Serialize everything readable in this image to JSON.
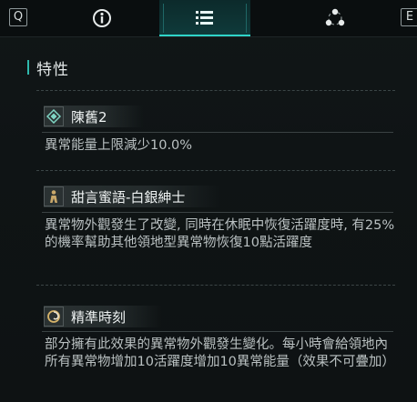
{
  "tabbar": {
    "left_key": "Q",
    "right_key": "E",
    "tabs": [
      {
        "icon": "info-icon"
      },
      {
        "icon": "list-icon",
        "active": true
      },
      {
        "icon": "network-icon"
      }
    ],
    "accent_color": "#2fd4c8"
  },
  "section": {
    "title": "特性"
  },
  "traits": [
    {
      "name": "陳舊2",
      "icon": "diamond-icon",
      "icon_color": "#7fd6c4",
      "description": "異常能量上限減少10.0%"
    },
    {
      "name": "甜言蜜語-白銀紳士",
      "icon": "figure-icon",
      "icon_color": "#c9a86a",
      "description": "異常物外觀發生了改變, 同時在休眠中恢復活躍度時, 有25%的機率幫助其他領地型異常物恢復10點活躍度"
    },
    {
      "name": "精準時刻",
      "icon": "swirl-icon",
      "icon_color": "#d7b46a",
      "description": "部分擁有此效果的異常物外觀發生變化。每小時會給領地內所有異常物增加10活躍度增加10異常能量（效果不可疊加）"
    }
  ]
}
